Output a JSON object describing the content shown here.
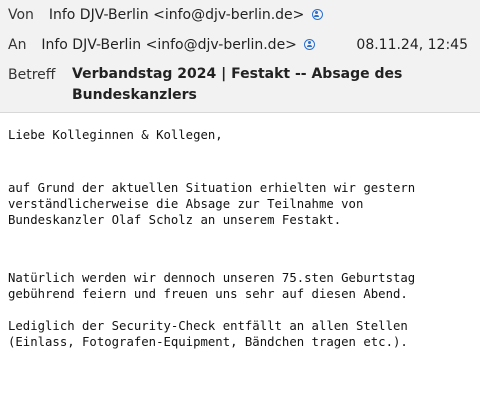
{
  "header": {
    "from_label": "Von",
    "from_value": "Info DJV-Berlin <info@djv-berlin.de>",
    "to_label": "An",
    "to_value": "Info DJV-Berlin <info@djv-berlin.de>",
    "date": "08.11.24, 12:45",
    "subject_label": "Betreff",
    "subject_line1": "Verbandstag 2024 | Festakt -- Absage des",
    "subject_line2": "Bundeskanzlers",
    "contact_icon": "contact-icon",
    "accent_color": "#2a6fd1"
  },
  "body": {
    "greeting": "Liebe Kolleginnen & Kollegen,",
    "para1": [
      "auf Grund der aktuellen Situation erhielten wir gestern",
      "verständlicherweise die Absage zur Teilnahme von",
      "Bundeskanzler Olaf Scholz an unserem Festakt."
    ],
    "para2": [
      "Natürlich werden wir dennoch unseren 75.sten Geburtstag",
      "gebührend feiern und freuen uns sehr auf diesen Abend."
    ],
    "para3": [
      "Lediglich der Security-Check entfällt an allen Stellen",
      "(Einlass, Fotografen-Equipment, Bändchen tragen etc.)."
    ]
  }
}
